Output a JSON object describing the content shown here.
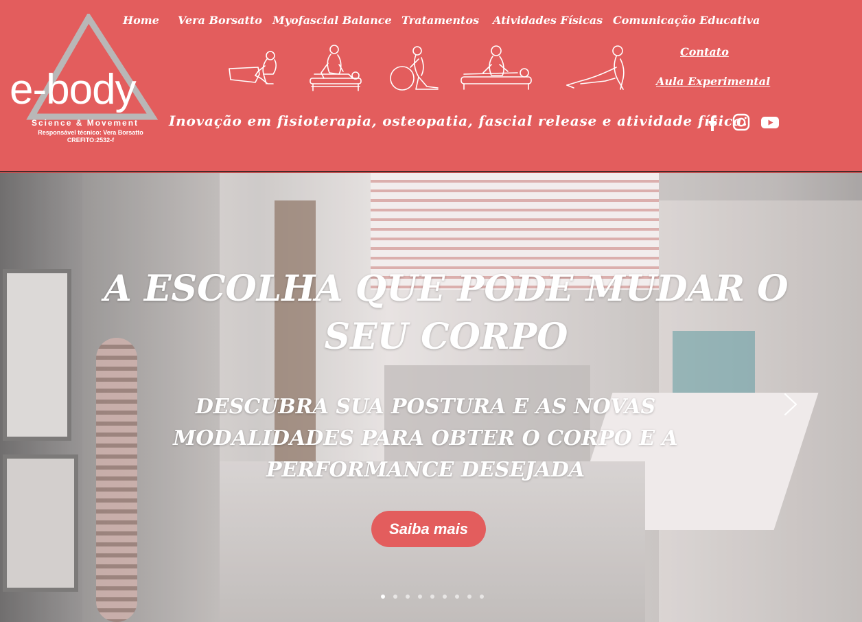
{
  "logo": {
    "word": "e-body",
    "subtitle": "Science & Movement",
    "responsible": "Responsável técnico: Vera Borsatto",
    "crefito": "CREFITO:2532-f"
  },
  "nav": {
    "items": [
      {
        "label": "Home"
      },
      {
        "label": "Vera Borsatto"
      },
      {
        "label": "Myofascial Balance"
      },
      {
        "label": "Tratamentos"
      },
      {
        "label": "Atividades Físicas"
      },
      {
        "label": "Comunicação Educativa"
      }
    ],
    "contato": "Contato",
    "aula": "Aula Experimental"
  },
  "tagline": "Inovação em fisioterapia, osteopatia, fascial release e atividade física.",
  "social": [
    {
      "icon": "facebook-icon"
    },
    {
      "icon": "instagram-icon"
    },
    {
      "icon": "youtube-icon"
    }
  ],
  "hero": {
    "title": "A ESCOLHA QUE PODE MUDAR O SEU CORPO",
    "subtitle": "DESCUBRA SUA POSTURA E AS NOVAS MODALIDADES PARA OBTER O CORPO E A PERFORMANCE DESEJADA",
    "cta": "Saiba mais",
    "slides_total": 9,
    "slide_active": 1
  },
  "colors": {
    "brand": "#e35d5d",
    "text": "#ffffff"
  }
}
